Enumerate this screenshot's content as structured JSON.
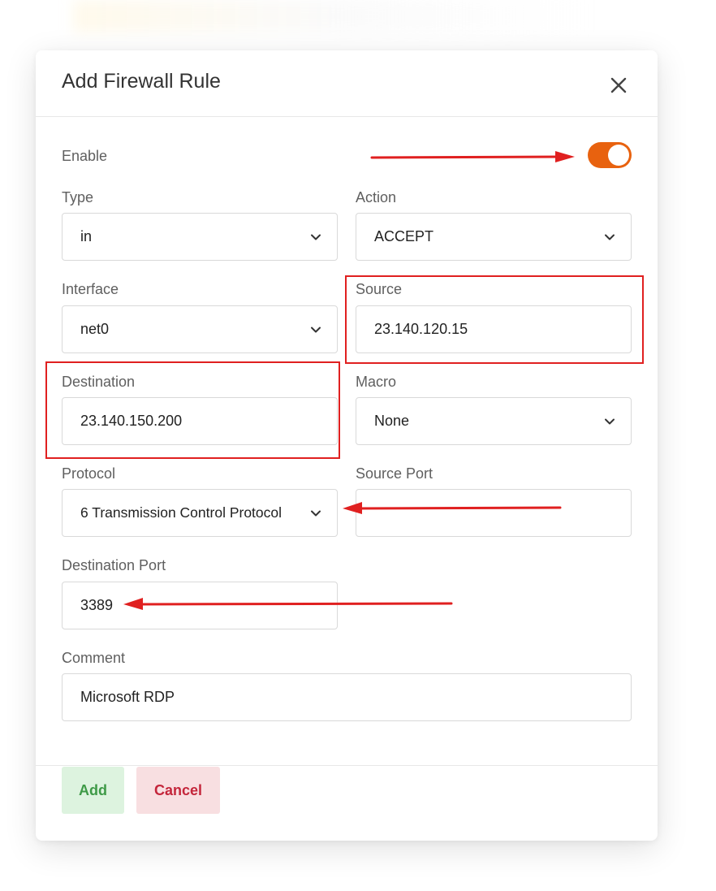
{
  "dialog": {
    "title": "Add Firewall Rule"
  },
  "fields": {
    "enable": {
      "label": "Enable",
      "checked": true
    },
    "type": {
      "label": "Type",
      "value": "in"
    },
    "action": {
      "label": "Action",
      "value": "ACCEPT"
    },
    "interface": {
      "label": "Interface",
      "value": "net0"
    },
    "source": {
      "label": "Source",
      "value": "23.140.120.15"
    },
    "destination": {
      "label": "Destination",
      "value": "23.140.150.200"
    },
    "macro": {
      "label": "Macro",
      "value": "None"
    },
    "protocol": {
      "label": "Protocol",
      "value": "6 Transmission Control Protocol"
    },
    "source_port": {
      "label": "Source Port",
      "value": ""
    },
    "destination_port": {
      "label": "Destination Port",
      "value": "3389"
    },
    "comment": {
      "label": "Comment",
      "value": "Microsoft RDP"
    }
  },
  "buttons": {
    "add": "Add",
    "cancel": "Cancel"
  },
  "colors": {
    "toggle_on": "#e8620f",
    "annotation": "#e02020",
    "add_bg": "#ddf3df",
    "add_text": "#3e9a47",
    "cancel_bg": "#f8dfe1",
    "cancel_text": "#c4263b"
  },
  "icons": {
    "close": "close-icon",
    "dropdown": "chevron-down-icon"
  }
}
